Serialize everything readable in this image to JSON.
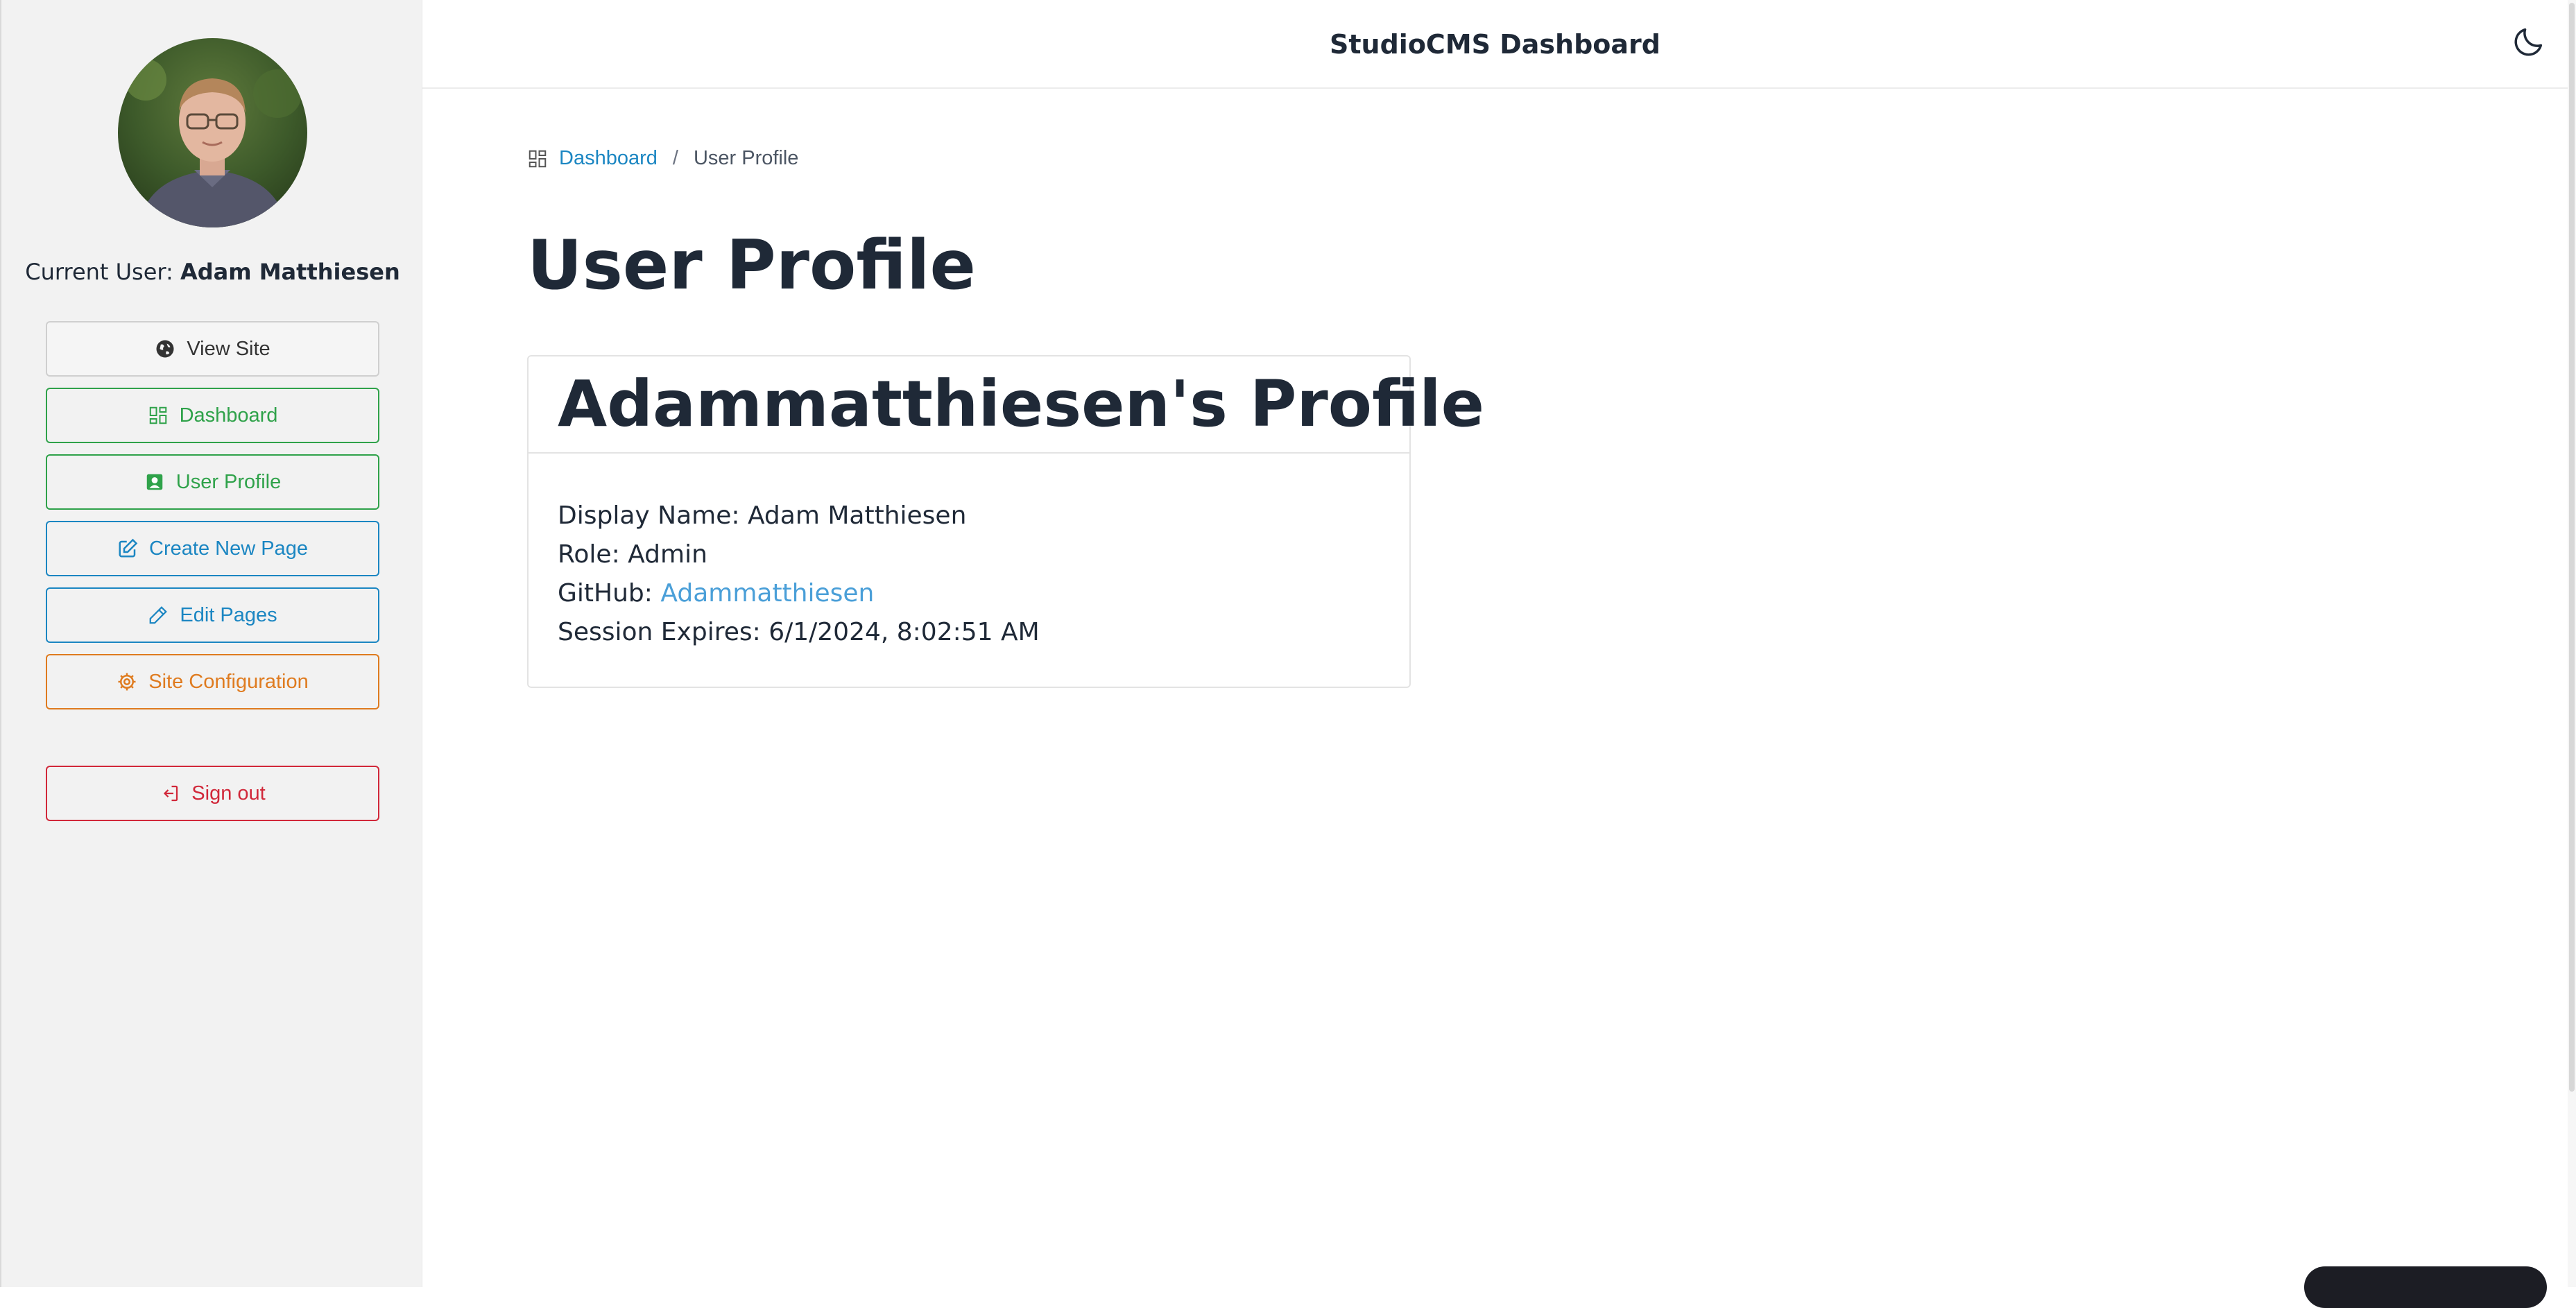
{
  "app": {
    "header_title": "StudioCMS Dashboard"
  },
  "sidebar": {
    "current_user_prefix": "Current User:",
    "current_user_name": "Adam Matthiesen",
    "buttons": [
      {
        "label": "View Site",
        "icon": "globe-icon",
        "color": "#333333"
      },
      {
        "label": "Dashboard",
        "icon": "dashboard-icon",
        "color": "#2fa24a"
      },
      {
        "label": "User Profile",
        "icon": "user-profile-icon",
        "color": "#2fa24a"
      },
      {
        "label": "Create New Page",
        "icon": "edit-square-icon",
        "color": "#1b86c2"
      },
      {
        "label": "Edit Pages",
        "icon": "pencil-icon",
        "color": "#1b86c2"
      },
      {
        "label": "Site Configuration",
        "icon": "gear-icon",
        "color": "#df7b1f"
      }
    ],
    "sign_out": {
      "label": "Sign out",
      "icon": "sign-out-icon",
      "color": "#d1283a"
    }
  },
  "breadcrumb": {
    "items": [
      {
        "label": "Dashboard",
        "icon": "dashboard-icon"
      },
      {
        "label": "User Profile"
      }
    ],
    "separator": "/"
  },
  "main": {
    "page_title": "User Profile",
    "profile_card": {
      "title": "Adammatthiesen's Profile",
      "display_name_label": "Display Name:",
      "display_name": "Adam Matthiesen",
      "role_label": "Role:",
      "role": "Admin",
      "github_label": "GitHub:",
      "github_link": "Adammatthiesen",
      "session_label": "Session Expires:",
      "session_expires": "6/1/2024, 8:02:51 AM"
    }
  },
  "theme": {
    "toggle_icon": "moon-icon"
  },
  "colors": {
    "accent_blue": "#1b86c2",
    "accent_green": "#2fa24a",
    "accent_orange": "#df7b1f",
    "accent_red": "#d1283a",
    "link_light_blue": "#4a9fd8",
    "text_dark": "#1f2937"
  }
}
